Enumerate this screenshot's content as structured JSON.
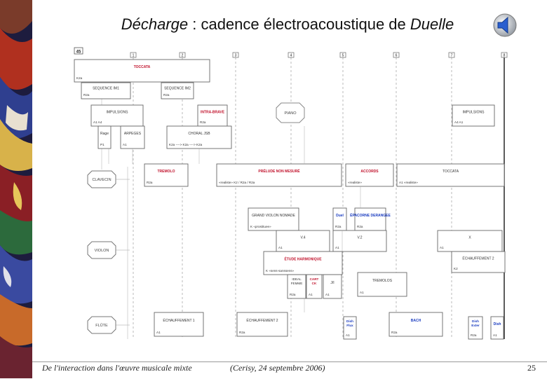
{
  "slide": {
    "title_word1": "Décharge",
    "title_middle": " : cadence électroacoustique de ",
    "title_word2": "Duelle",
    "footer_left": "De l'interaction dans l'œuvre musicale mixte",
    "footer_center": "(Cerisy, 24 septembre 2006)",
    "page_number": "25",
    "audio_icon": "speaker-icon"
  },
  "score": {
    "header_number": "45",
    "sections": [
      "1",
      "2",
      "3",
      "4",
      "5",
      "6",
      "7",
      "8"
    ],
    "instruments": [
      "CLAVECIN",
      "VIOLON",
      "FLÛTE"
    ],
    "blocks": [
      {
        "label": "TOCCATA",
        "sub": "K2a",
        "red": true
      },
      {
        "label": "SEQUENCE IM1",
        "sub": "R2a"
      },
      {
        "label": "SEQUENCE IM2",
        "sub": "R2a"
      },
      {
        "label": "IMPULSIONS",
        "sub": "A1    A4"
      },
      {
        "label": "INTRA-BRAVE",
        "sub": "R2a",
        "red": true
      },
      {
        "label": "PIANO",
        "sub": ""
      },
      {
        "label": "IMPULSIONS",
        "sub": "A4    A1"
      },
      {
        "label": "Rage",
        "sub": "P1"
      },
      {
        "label": "ARPEGES",
        "sub": "A1"
      },
      {
        "label": "CHORAL JSB",
        "sub": "K2a ----> K2a ----> K2a"
      },
      {
        "label": "TREMOLO",
        "sub": "R2a",
        "red": true
      },
      {
        "label": "PRÉLUDE NON MESURÉ",
        "sub": "«realiste»    K2  / R2a /  R2a",
        "red": true
      },
      {
        "label": "ACCORDS",
        "sub": "«realiste»",
        "red": true
      },
      {
        "label": "TOCCATA",
        "sub": "A1          «realiste»"
      },
      {
        "label": "GRAND VIOLON NOMADE",
        "sub": "K «prostituee»"
      },
      {
        "label": "Duel",
        "sub": "R2a",
        "blue": true
      },
      {
        "label": "ÉPACORNE DERANGEE",
        "sub": "R2a",
        "blue": true
      },
      {
        "label": "V.4",
        "sub": "A1"
      },
      {
        "label": "V.2",
        "sub": "A1"
      },
      {
        "label": "X",
        "sub": "A1"
      },
      {
        "label": "ÉCHAUFFEMENT 2",
        "sub": "K2"
      },
      {
        "label": "ÉTUDE HARMONIQUE",
        "sub": "K «sens-sanssens»",
        "red": true
      },
      {
        "label": "IDEAL FEMME",
        "sub": "R2a"
      },
      {
        "label": "CART CK",
        "sub": "A1",
        "red": true
      },
      {
        "label": "J/I",
        "sub": "A1"
      },
      {
        "label": "TREMOLOS",
        "sub": "A1"
      },
      {
        "label": "ÉCHAUFFEMENT 1",
        "sub": "A1"
      },
      {
        "label": "ÉCHAUFFEMENT 2",
        "sub": "R2a"
      },
      {
        "label": "Dish Flux",
        "sub": "A1",
        "blue": true
      },
      {
        "label": "BACH",
        "sub": "R2a",
        "blue": true
      },
      {
        "label": "Dish Exter",
        "sub": "R2a",
        "blue": true
      },
      {
        "label": "Dish",
        "sub": "A1",
        "blue": true
      }
    ]
  },
  "colors": {
    "red": "#c0102a",
    "blue": "#1a3cc0",
    "line": "#444",
    "icon_blue": "#2a5fcf"
  }
}
